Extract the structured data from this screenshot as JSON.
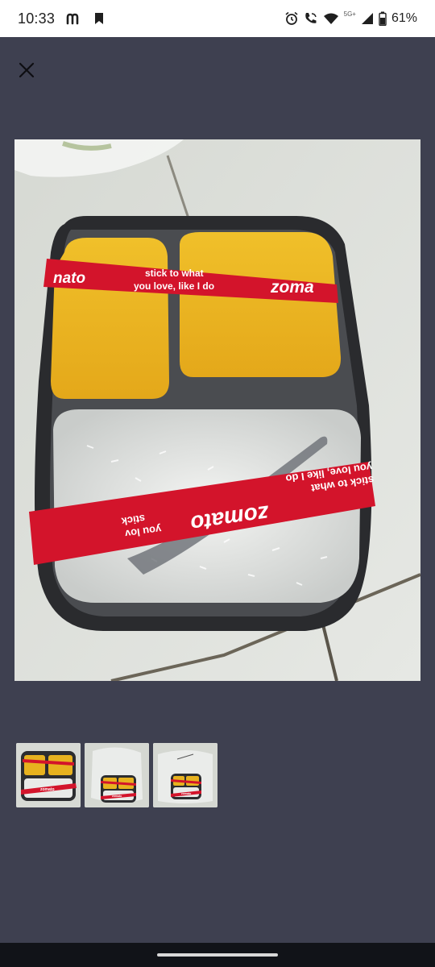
{
  "status_bar": {
    "time": "10:33",
    "notification_icons": [
      "m-app-icon",
      "bookmark-icon"
    ],
    "right_icons": [
      "alarm-icon",
      "wifi-calling-icon",
      "wifi-icon",
      "signal-icon",
      "battery-icon"
    ],
    "network_label": "5G+",
    "battery": "61%"
  },
  "viewer": {
    "close_icon": "close-icon",
    "main_photo": {
      "tape_text_1": "stick to what",
      "tape_text_2": "you love, like I do",
      "brand": "zomato",
      "brand_partial_left": "nato",
      "brand_partial_right": "zoma",
      "tape_rev_1": "stick to what",
      "tape_rev_2": "you love, like I do",
      "tape_rev_left": "you lov",
      "tape_rev_left2": "stick"
    },
    "thumbnails": [
      {
        "label": "zomato"
      },
      {
        "label": "zomato"
      },
      {
        "label": "zomato"
      }
    ]
  },
  "colors": {
    "background": "#3e4050",
    "status_bar": "#ffffff",
    "nav_bar": "#111318",
    "tape_red": "#d3142b",
    "dal_yellow": "#e9b422"
  }
}
